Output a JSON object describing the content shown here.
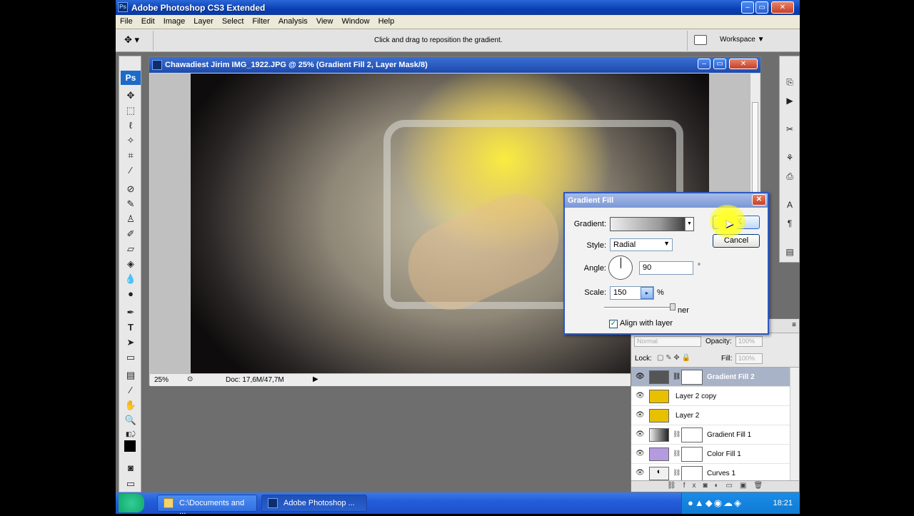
{
  "app": {
    "title": "Adobe Photoshop CS3 Extended"
  },
  "menu": [
    "File",
    "Edit",
    "Image",
    "Layer",
    "Select",
    "Filter",
    "Analysis",
    "View",
    "Window",
    "Help"
  ],
  "options_bar": {
    "hint": "Click and drag to reposition the gradient.",
    "workspace_label": "Workspace ▼"
  },
  "document": {
    "title": "Chawadiest Jirim IMG_1922.JPG @ 25% (Gradient Fill 2, Layer Mask/8)",
    "status_zoom": "25%",
    "status_doc": "Doc: 17,6M/47,7M"
  },
  "dialog": {
    "title": "Gradient Fill",
    "gradient_label": "Gradient:",
    "style_label": "Style:",
    "style_value": "Radial",
    "angle_label": "Angle:",
    "angle_value": "90",
    "angle_unit": "°",
    "scale_label": "Scale:",
    "scale_value": "150",
    "scale_unit": "%",
    "reverse_partial": "ner",
    "align_label": "Align with layer",
    "align_checked": true,
    "ok_label": "OK",
    "cancel_label": "Cancel"
  },
  "layers_panel": {
    "blend_mode": "Normal",
    "opacity_label": "Opacity:",
    "opacity_value": "100%",
    "lock_label": "Lock:",
    "fill_label": "Fill:",
    "fill_value": "100%",
    "layers": [
      {
        "name": "Gradient Fill 2",
        "active": true,
        "thumb_color": "#555555"
      },
      {
        "name": "Layer 2 copy",
        "active": false,
        "thumb_color": "#e8c000"
      },
      {
        "name": "Layer 2",
        "active": false,
        "thumb_color": "#e8c000"
      },
      {
        "name": "Gradient Fill 1",
        "active": false,
        "thumb_color": "#555555"
      },
      {
        "name": "Color Fill 1",
        "active": false,
        "thumb_color": "#b49be0"
      },
      {
        "name": "Curves 1",
        "active": false,
        "thumb_color": "#f0f0f0"
      }
    ]
  },
  "taskbar": {
    "tasks": [
      {
        "label": "C:\\Documents and ..."
      },
      {
        "label": "Adobe Photoshop ..."
      }
    ],
    "clock": "18:21"
  }
}
